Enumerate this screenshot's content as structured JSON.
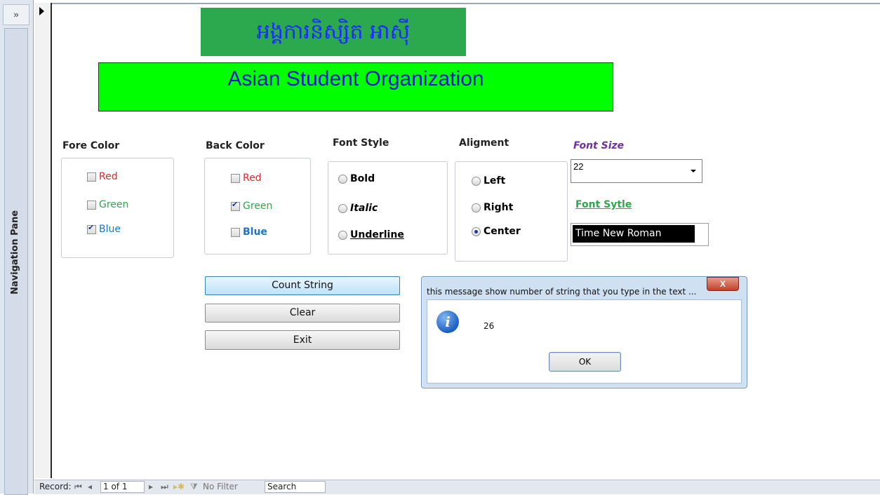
{
  "nav_pane": {
    "toggle": "»",
    "label": "Navigation Pane"
  },
  "header": {
    "khmer_title": "អង្គការនិស្សិត អាស៊ី",
    "english_title": "Asian Student Organization"
  },
  "fore_color": {
    "label": "Fore Color",
    "options": [
      {
        "label": "Red",
        "checked": false,
        "color": "#e0262b"
      },
      {
        "label": "Green",
        "checked": false,
        "color": "#2aa84a"
      },
      {
        "label": "Blue",
        "checked": true,
        "color": "#1f74c9"
      }
    ]
  },
  "back_color": {
    "label": "Back Color",
    "options": [
      {
        "label": "Red",
        "checked": false,
        "color": "#e0262b"
      },
      {
        "label": "Green",
        "checked": true,
        "color": "#2aa84a"
      },
      {
        "label": "Blue",
        "checked": false,
        "color": "#1f74c9"
      }
    ]
  },
  "font_style_group": {
    "label": "Font Style",
    "options": [
      {
        "label": "Bold",
        "selected": false
      },
      {
        "label": "Italic",
        "selected": false
      },
      {
        "label": "Underline",
        "selected": false
      }
    ]
  },
  "alignment_group": {
    "label": "Aligment",
    "options": [
      {
        "label": "Left",
        "selected": false
      },
      {
        "label": "Right",
        "selected": false
      },
      {
        "label": "Center",
        "selected": true
      }
    ]
  },
  "font_size": {
    "label": "Font Size",
    "value": "22",
    "label_color": "#7030a0"
  },
  "font_sytle": {
    "label": "Font  Sytle",
    "value": "Time New Roman",
    "label_color": "#2aa84a"
  },
  "buttons": {
    "count": "Count String",
    "clear": "Clear",
    "exit": "Exit"
  },
  "message_box": {
    "title": "this message show number of string that you type in the text ...",
    "close": "X",
    "icon": "information-icon",
    "message": "26",
    "ok": "OK"
  },
  "status_bar": {
    "record_label": "Record:",
    "record_value": "1 of 1",
    "filter": "No Filter",
    "search": "Search"
  }
}
